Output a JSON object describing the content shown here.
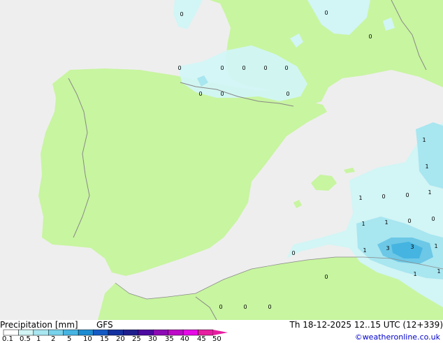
{
  "colors": {
    "sea": "#eeeeee",
    "land": "#c8f5a0",
    "border": "#888888",
    "precip_light": "#d2f5f5",
    "precip_mid": "#a8e6f0",
    "precip_heavy": "#6cc8e6",
    "precip_core": "#46b4e1"
  },
  "map": {
    "point_labels": [
      "0",
      "0",
      "0",
      "0",
      "0",
      "0",
      "0",
      "0",
      "0",
      "0",
      "0",
      "0",
      "0",
      "1",
      "1",
      "1",
      "1",
      "1",
      "1",
      "1",
      "0",
      "0",
      "0",
      "1",
      "0",
      "1",
      "3",
      "3",
      "1",
      "1",
      "1",
      "0",
      "0",
      "0",
      "0"
    ]
  },
  "footer": {
    "title": "Precipitation [mm]",
    "model": "GFS",
    "valid_time": "Th 18-12-2025 12..15 UTC (12+339)",
    "credit": "©weatheronline.co.uk",
    "scale_colors": [
      "#ffffff",
      "#d2f5f5",
      "#a8e6f0",
      "#78d2eb",
      "#46b4e1",
      "#1e8cd2",
      "#145ac3",
      "#1430a0",
      "#1e1e8c",
      "#4b0aa0",
      "#8c0ab4",
      "#be0ac8",
      "#e60ae6",
      "#e61ea0"
    ],
    "scale_labels": [
      "0.1",
      "0.5",
      "1",
      "2",
      "5",
      "10",
      "15",
      "20",
      "25",
      "30",
      "35",
      "40",
      "45",
      "50"
    ]
  }
}
